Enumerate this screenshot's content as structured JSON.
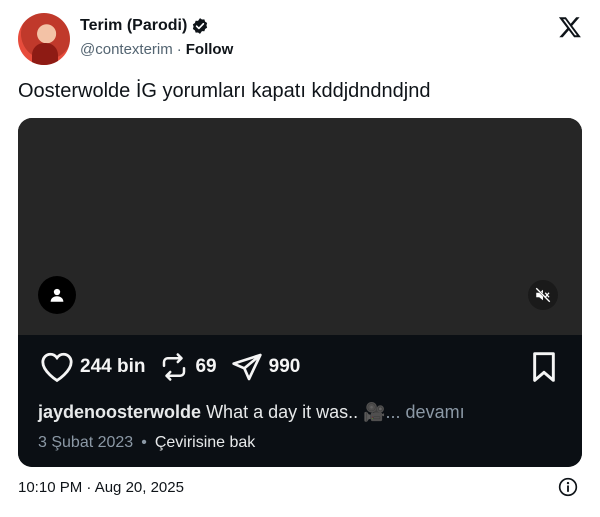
{
  "author": {
    "display_name": "Terim (Parodi)",
    "handle": "@contexterim",
    "separator": "·",
    "follow_label": "Follow",
    "verified_color": "#0f1419"
  },
  "tweet": {
    "text": "Oosterwolde İG yorumları kapatı kddjdndndjnd",
    "timestamp": "10:10 PM · Aug 20, 2025"
  },
  "embed": {
    "likes": "244 bin",
    "reposts": "69",
    "shares": "990",
    "caption_user": "jaydenoosterwolde",
    "caption_text": "What a day it was.. 🎥",
    "caption_more": "... devamı",
    "date": "3 Şubat 2023",
    "dot": "•",
    "translate_label": "Çevirisine bak"
  },
  "colors": {
    "video_bg": "#262626",
    "panel_bg": "#0b0f14",
    "text": "#0f1419",
    "muted": "#536471"
  }
}
